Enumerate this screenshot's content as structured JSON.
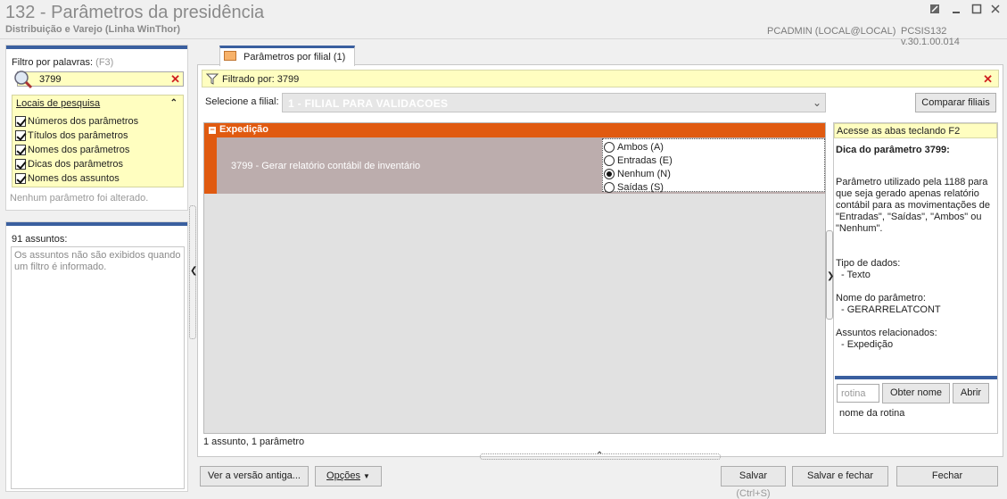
{
  "window": {
    "title": "132 - Parâmetros da presidência",
    "subtitle": "Distribuição e Varejo (Linha WinThor)",
    "user": "PCADMIN (LOCAL@LOCAL)",
    "version": "PCSIS132  v.30.1.00.014"
  },
  "filter": {
    "label": "Filtro por palavras:",
    "shortcut": "(F3)",
    "search_value": "3799",
    "locais_title": "Locais de pesquisa",
    "options": [
      "Números dos parâmetros",
      "Títulos dos parâmetros",
      "Nomes dos parâmetros",
      "Dicas dos parâmetros",
      "Nomes dos assuntos"
    ],
    "status": "Nenhum parâmetro foi alterado."
  },
  "assuntos": {
    "label": "91 assuntos:",
    "message": "Os assuntos não são exibidos quando um filtro é informado."
  },
  "tab": {
    "label": "Parâmetros por filial",
    "count": "(1)"
  },
  "filtered": {
    "text": "Filtrado por: 3799"
  },
  "branch": {
    "label": "Selecione a filial:",
    "value": "1 - FILIAL PARA VALIDACOES",
    "compare_label": "Comparar filiais"
  },
  "grid": {
    "group": "Expedição",
    "param_text": "3799 - Gerar relatório contábil de inventário",
    "radio_options": [
      "Ambos (A)",
      "Entradas (E)",
      "Nenhum (N)",
      "Saídas (S)"
    ],
    "selected": "Nenhum (N)"
  },
  "status_text": "1 assunto, 1 parâmetro",
  "help": {
    "hint": "Acesse as abas teclando F2",
    "dica_title": "Dica do parâmetro 3799:",
    "dica_desc": "Parâmetro utilizado pela 1188 para que seja gerado apenas relatório contábil para as movimentações de \"Entradas\", \"Saídas\", \"Ambos\" ou \"Nenhum\".",
    "tipo_label": "Tipo de dados:",
    "tipo_value": "- Texto",
    "nome_label": "Nome do parâmetro:",
    "nome_value": "- GERARRELATCONT",
    "assuntos_label": "Assuntos relacionados:",
    "assuntos_value": "- Expedição",
    "rotina_placeholder": "rotina",
    "obter_label": "Obter nome",
    "abrir_label": "Abrir",
    "rotina_name": "nome da rotina"
  },
  "buttons": {
    "old_version": "Ver a versão antiga...",
    "options": "Opções",
    "save": "Salvar",
    "save_shortcut": "(Ctrl+S)",
    "save_close": "Salvar e fechar",
    "close": "Fechar"
  },
  "colors": {
    "accent_blue": "#3a5f9f",
    "group_orange": "#e05a10",
    "highlight_yellow": "#fffec0"
  }
}
